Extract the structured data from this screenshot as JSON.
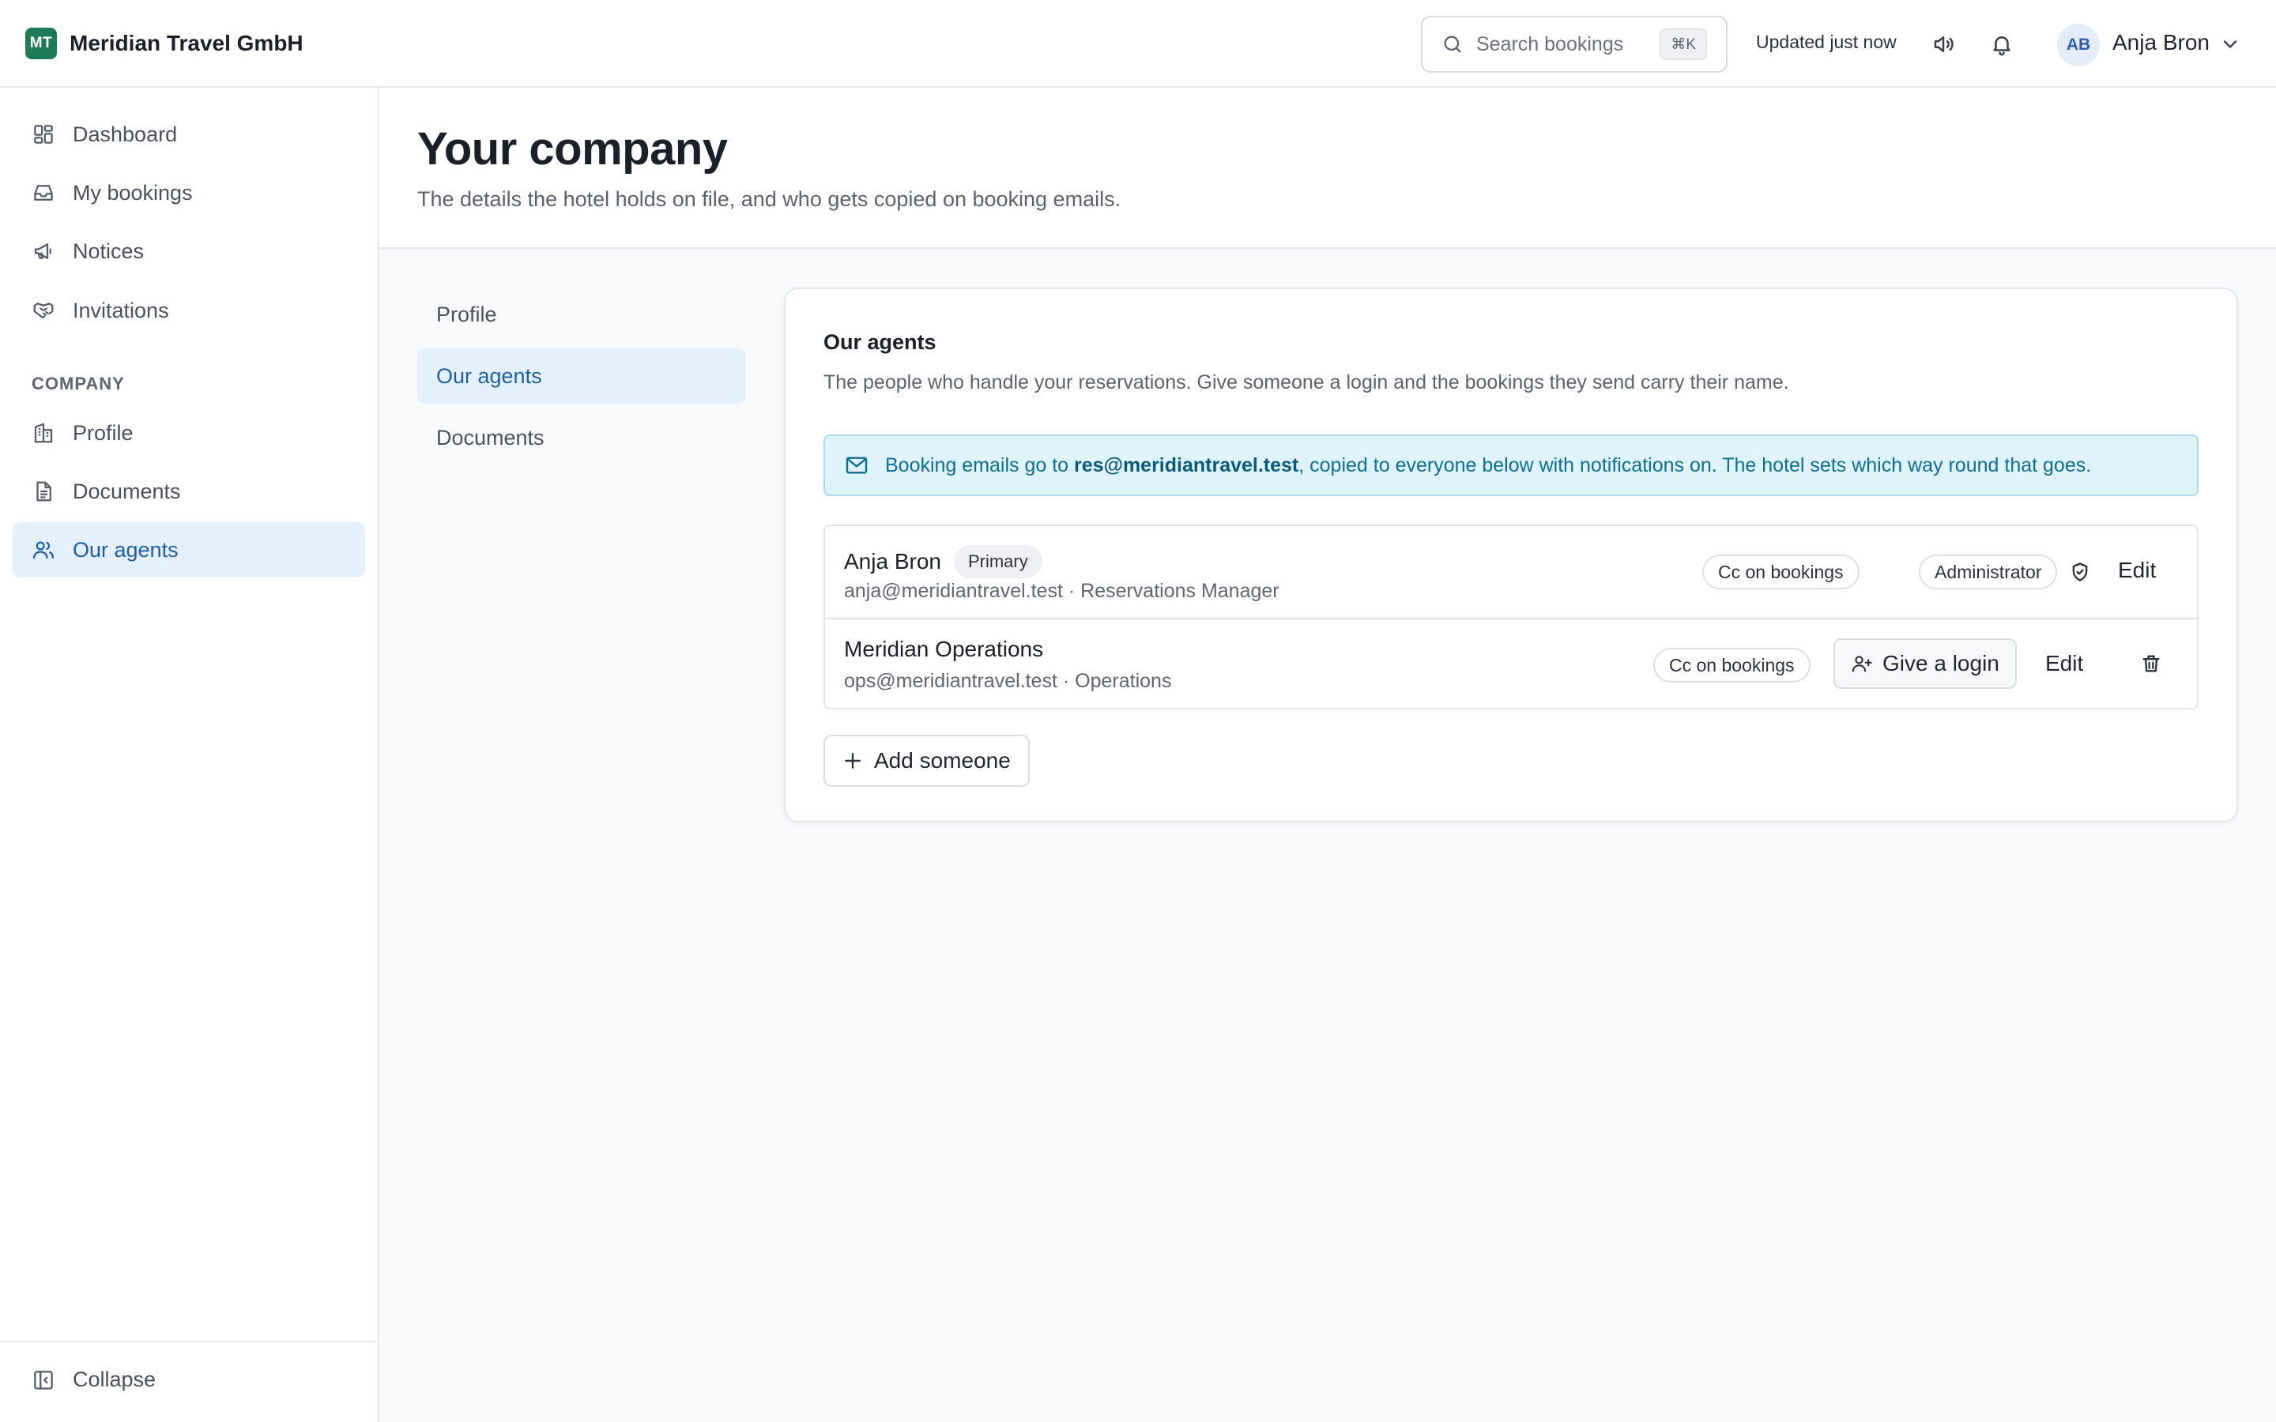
{
  "header": {
    "brand_initials": "MT",
    "brand_name": "Meridian Travel GmbH",
    "search_placeholder": "Search bookings",
    "search_shortcut": "⌘K",
    "status": "Updated just now",
    "user_initials": "AB",
    "user_name": "Anja Bron"
  },
  "sidebar": {
    "items": [
      {
        "label": "Dashboard",
        "icon": "dashboard-icon"
      },
      {
        "label": "My bookings",
        "icon": "inbox-icon"
      },
      {
        "label": "Notices",
        "icon": "megaphone-icon"
      },
      {
        "label": "Invitations",
        "icon": "handshake-icon"
      }
    ],
    "section_label": "COMPANY",
    "company_items": [
      {
        "label": "Profile",
        "icon": "building-icon"
      },
      {
        "label": "Documents",
        "icon": "document-icon"
      },
      {
        "label": "Our agents",
        "icon": "users-icon",
        "active": true
      }
    ],
    "collapse_label": "Collapse"
  },
  "page": {
    "title": "Your company",
    "subtitle": "The details the hotel holds on file, and who gets copied on booking emails."
  },
  "subnav": {
    "items": [
      "Profile",
      "Our agents",
      "Documents"
    ],
    "active": "Our agents"
  },
  "card": {
    "title": "Our agents",
    "description": "The people who handle your reservations. Give someone a login and the bookings they send carry their name.",
    "notice": {
      "prefix": "Booking emails go to ",
      "email": "res@meridiantravel.test",
      "suffix": ", copied to everyone below with notifications on. The hotel sets which way round that goes."
    },
    "agents": [
      {
        "name": "Anja Bron",
        "badge": "Primary",
        "meta": "anja@meridiantravel.test · Reservations Manager",
        "cc_label": "Cc on bookings",
        "role": "Administrator",
        "edit_label": "Edit"
      },
      {
        "name": "Meridian Operations",
        "meta": "ops@meridiantravel.test · Operations",
        "cc_label": "Cc on bookings",
        "login_label": "Give a login",
        "edit_label": "Edit"
      }
    ],
    "add_label": "Add someone"
  },
  "colors": {
    "brand": "#1f7a58",
    "active_bg": "#e4f0fc",
    "active_text": "#1f5f9e",
    "notice_bg": "#dff3fa",
    "notice_text": "#0f6d8f"
  }
}
